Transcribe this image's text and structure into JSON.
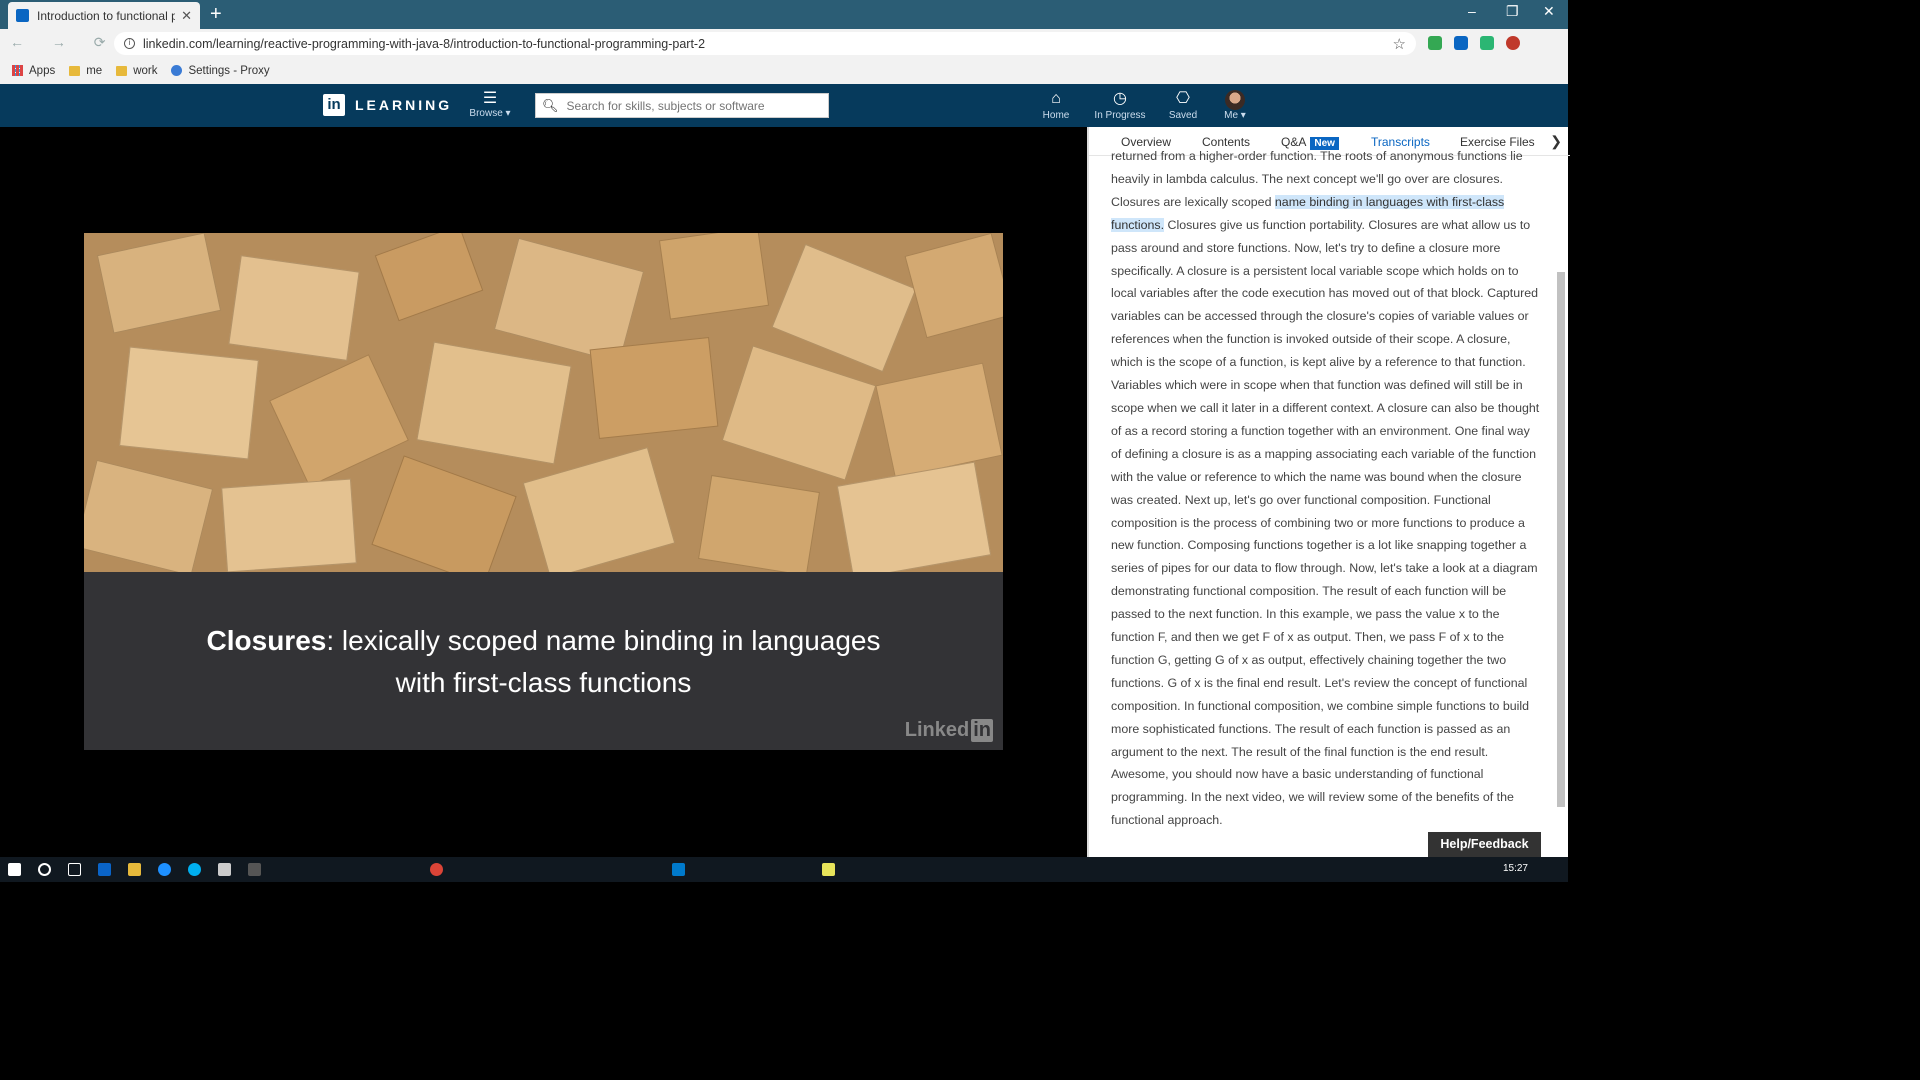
{
  "browser": {
    "tab_title": "Introduction to functional pr",
    "tab_close": "✕",
    "new_tab": "+",
    "url": "linkedin.com/learning/reactive-programming-with-java-8/introduction-to-functional-programming-part-2",
    "window_controls": [
      "–",
      "❐",
      "✕"
    ]
  },
  "bookmarks": [
    {
      "label": "Apps",
      "icon": "apps-grid-icon"
    },
    {
      "label": "me",
      "icon": "folder-icon"
    },
    {
      "label": "work",
      "icon": "folder-icon"
    },
    {
      "label": "Settings - Proxy",
      "icon": "gear-icon"
    }
  ],
  "header": {
    "logo_in": "in",
    "logo_text": "LEARNING",
    "browse_label": "Browse ▾",
    "search_placeholder": "Search for skills, subjects or software",
    "nav": [
      {
        "label": "Home",
        "icon": "home-icon",
        "glyph": "⌂"
      },
      {
        "label": "In Progress",
        "icon": "clock-icon",
        "glyph": "◷"
      },
      {
        "label": "Saved",
        "icon": "bookmark-icon",
        "glyph": "⎔"
      },
      {
        "label": "Me ▾",
        "icon": "avatar"
      }
    ]
  },
  "video": {
    "caption_bold": "Closures",
    "caption_rest": ": lexically scoped name binding in languages",
    "caption_line2": "with first-class functions",
    "watermark_text": "Linked",
    "watermark_in": "in"
  },
  "sidebar": {
    "tabs": [
      {
        "label": "Overview",
        "active": false
      },
      {
        "label": "Contents",
        "active": false
      },
      {
        "label": "Q&A",
        "active": false,
        "badge": "New"
      },
      {
        "label": "Transcripts",
        "active": true
      },
      {
        "label": "Exercise Files",
        "active": false
      }
    ],
    "chevron": "❯",
    "transcript_before": "returned from a higher-order function. The roots of anonymous functions lie heavily in lambda calculus. The next concept we'll go over are closures. Closures are lexically scoped ",
    "transcript_highlight": "name binding in languages with first-class functions.",
    "transcript_after": " Closures give us function portability. Closures are what allow us to pass around and store functions. Now, let's try to define a closure more specifically. A closure is a persistent local variable scope which holds on to local variables after the code execution has moved out of that block. Captured variables can be accessed through the closure's copies of variable values or references when the function is invoked outside of their scope. A closure, which is the scope of a function, is kept alive by a reference to that function. Variables which were in scope when that function was defined will still be in scope when we call it later in a different context. A closure can also be thought of as a record storing a function together with an environment. One final way of defining a closure is as a mapping associating each variable of the function with the value or reference to which the name was bound when the closure was created. Next up, let's go over functional composition. Functional composition is the process of combining two or more functions to produce a new function. Composing functions together is a lot like snapping together a series of pipes for our data to flow through. Now, let's take a look at a diagram demonstrating functional composition. The result of each function will be passed to the next function. In this example, we pass the value x to the function F, and then we get F of x as output. Then, we pass F of x to the function G, getting G of x as output, effectively chaining together the two functions. G of x is the final end result. Let's review the concept of functional composition. In functional composition, we combine simple functions to build more sophisticated functions. The result of each function is passed as an argument to the next. The result of the final function is the end result. Awesome, you should now have a basic understanding of functional programming. In the next video, we will review some of the benefits of the functional approach.",
    "help_label": "Help/Feedback"
  },
  "taskbar": {
    "clock": "15:27"
  }
}
